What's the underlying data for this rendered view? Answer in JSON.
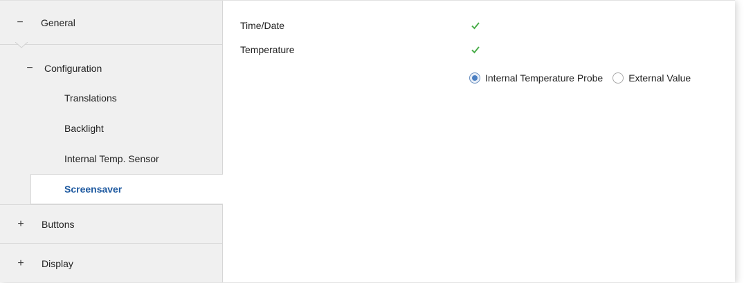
{
  "sidebar": {
    "general": {
      "sign": "−",
      "label": "General"
    },
    "configuration": {
      "sign": "−",
      "label": "Configuration"
    },
    "sub_items": [
      {
        "label": "Translations"
      },
      {
        "label": "Backlight"
      },
      {
        "label": "Internal Temp. Sensor"
      },
      {
        "label": "Screensaver",
        "selected": true
      }
    ],
    "buttons": {
      "sign": "+",
      "label": "Buttons"
    },
    "display": {
      "sign": "+",
      "label": "Display"
    }
  },
  "content": {
    "time_date": {
      "label": "Time/Date",
      "checked": true
    },
    "temperature": {
      "label": "Temperature",
      "checked": true
    },
    "temperature_source": {
      "selected": "Internal Temperature Probe",
      "options": [
        "Internal Temperature Probe",
        "External Value"
      ]
    }
  },
  "colors": {
    "accent": "#1f5aa0",
    "check": "#4cae4c",
    "sidebar_bg": "#f0f0f0"
  }
}
